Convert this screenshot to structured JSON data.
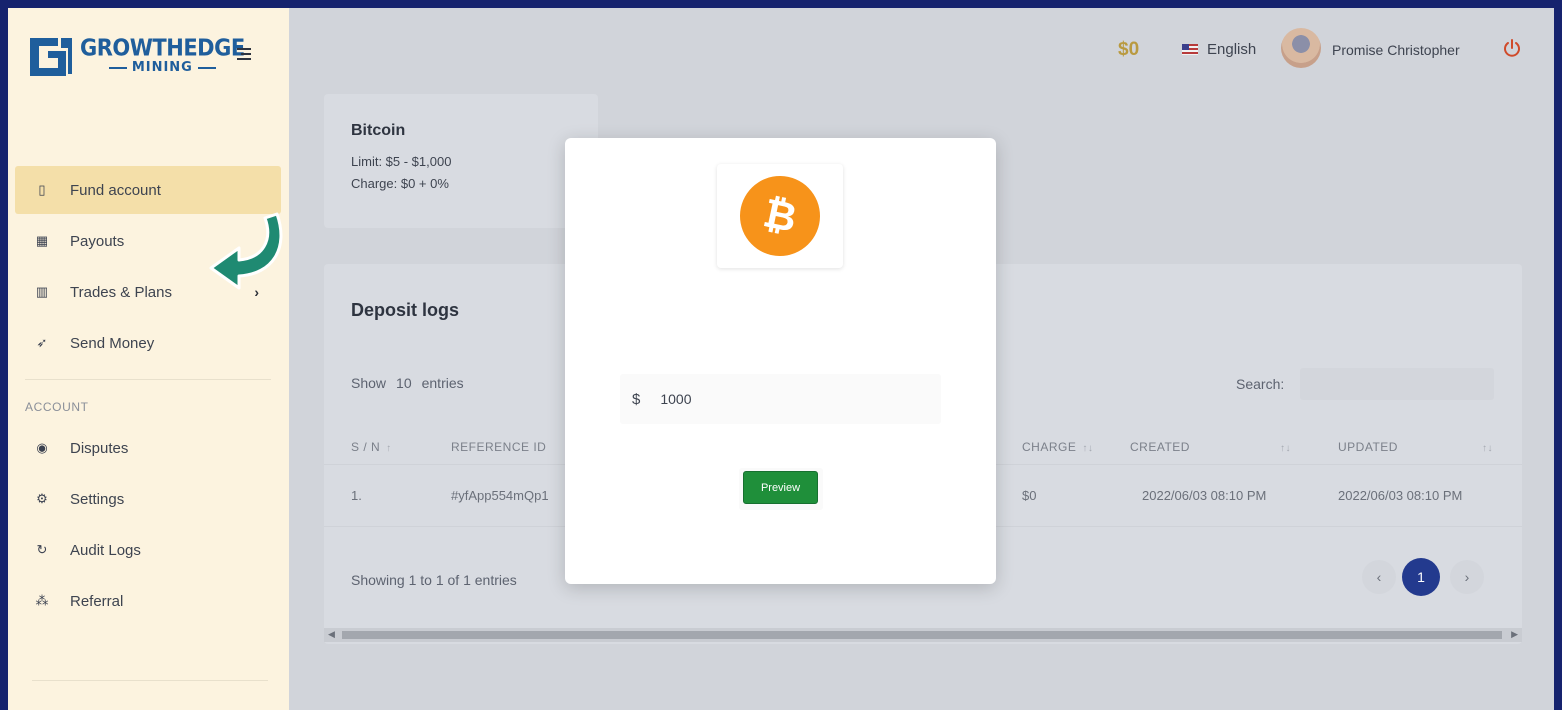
{
  "logo": {
    "top": "GROWTHEDGE",
    "bottom": "MINING"
  },
  "topbar": {
    "balance": "$0",
    "language": "English",
    "username": "Promise Christopher"
  },
  "sidebar": {
    "items": [
      {
        "label": "Fund account",
        "icon": "bookmark-icon",
        "active": true
      },
      {
        "label": "Payouts",
        "icon": "calendar-check-icon"
      },
      {
        "label": "Trades & Plans",
        "icon": "bar-chart-icon",
        "has_submenu": true
      },
      {
        "label": "Send Money",
        "icon": "paper-plane-icon"
      }
    ],
    "section_label": "ACCOUNT",
    "account_items": [
      {
        "label": "Disputes",
        "icon": "target-icon"
      },
      {
        "label": "Settings",
        "icon": "gears-icon"
      },
      {
        "label": "Audit Logs",
        "icon": "refresh-icon"
      },
      {
        "label": "Referral",
        "icon": "network-icon"
      }
    ]
  },
  "bitcoin_card": {
    "title": "Bitcoin",
    "limit": "Limit: $5 - $1,000",
    "charge": "Charge: $0 + 0%"
  },
  "deposit_logs": {
    "title": "Deposit logs",
    "show_label": "Show",
    "entries_value": "10",
    "entries_label": "entries",
    "search_label": "Search:",
    "columns": [
      "S / N",
      "REFERENCE ID",
      "CHARGE",
      "CREATED",
      "UPDATED"
    ],
    "rows": [
      {
        "sn": "1.",
        "reference": "#yfApp554mQp1",
        "charge": "$0",
        "created": "2022/06/03 08:10 PM",
        "updated": "2022/06/03 08:10 PM"
      }
    ],
    "showing_text": "Showing 1 to 1 of 1 entries",
    "pagination": {
      "prev": "‹",
      "current": "1",
      "next": "›"
    }
  },
  "modal": {
    "coin_symbol": "₿",
    "currency_symbol": "$",
    "amount_value": "1000",
    "preview_label": "Preview"
  },
  "colors": {
    "accent_blue": "#233a8e",
    "sidebar_bg": "#fcf3df",
    "active_item": "#f4dfa9",
    "bitcoin_orange": "#f7931a",
    "preview_green": "#1f8f3a",
    "annotation_arrow": "#1f8a72"
  }
}
